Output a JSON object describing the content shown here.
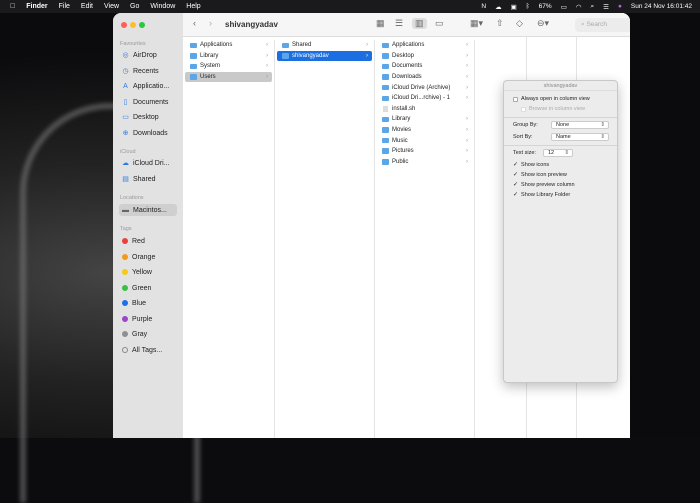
{
  "menubar": {
    "app": "Finder",
    "items": [
      "File",
      "Edit",
      "View",
      "Go",
      "Window",
      "Help"
    ],
    "battery": "67%",
    "datetime": "Sun 24 Nov  16:01:42"
  },
  "window": {
    "title": "shivangyadav",
    "search_placeholder": "Search"
  },
  "sidebar": {
    "favourites_label": "Favourites",
    "favourites": [
      "AirDrop",
      "Recents",
      "Applicatio...",
      "Documents",
      "Desktop",
      "Downloads"
    ],
    "icloud_label": "iCloud",
    "icloud": [
      "iCloud Dri...",
      "Shared"
    ],
    "locations_label": "Locations",
    "locations": [
      "Macintos..."
    ],
    "tags_label": "Tags",
    "tags": [
      {
        "label": "Red",
        "color": "#e8413b"
      },
      {
        "label": "Orange",
        "color": "#f39a1e"
      },
      {
        "label": "Yellow",
        "color": "#f4c918"
      },
      {
        "label": "Green",
        "color": "#3cbf45"
      },
      {
        "label": "Blue",
        "color": "#1e6ee8"
      },
      {
        "label": "Purple",
        "color": "#9a47c9"
      },
      {
        "label": "Gray",
        "color": "#8e8e93"
      }
    ],
    "all_tags": "All Tags..."
  },
  "columns": [
    [
      "Applications",
      "Library",
      "System",
      "Users"
    ],
    [
      "Shared",
      "shivangyadav"
    ],
    [
      "Applications",
      "Desktop",
      "Documents",
      "Downloads",
      "iCloud Drive (Archive)",
      "iCloud Dri...rchive) - 1",
      "install.sh",
      "Library",
      "Movies",
      "Music",
      "Pictures",
      "Public"
    ]
  ],
  "view_options": {
    "title": "shivangyadav",
    "always_open": "Always open in column view",
    "browse": "Browse in column view",
    "group_by_label": "Group By:",
    "group_by": "None",
    "sort_by_label": "Sort By:",
    "sort_by": "Name",
    "text_size_label": "Text size:",
    "text_size": "12",
    "checks": [
      "Show icons",
      "Show icon preview",
      "Show preview column",
      "Show Library Folder"
    ]
  }
}
